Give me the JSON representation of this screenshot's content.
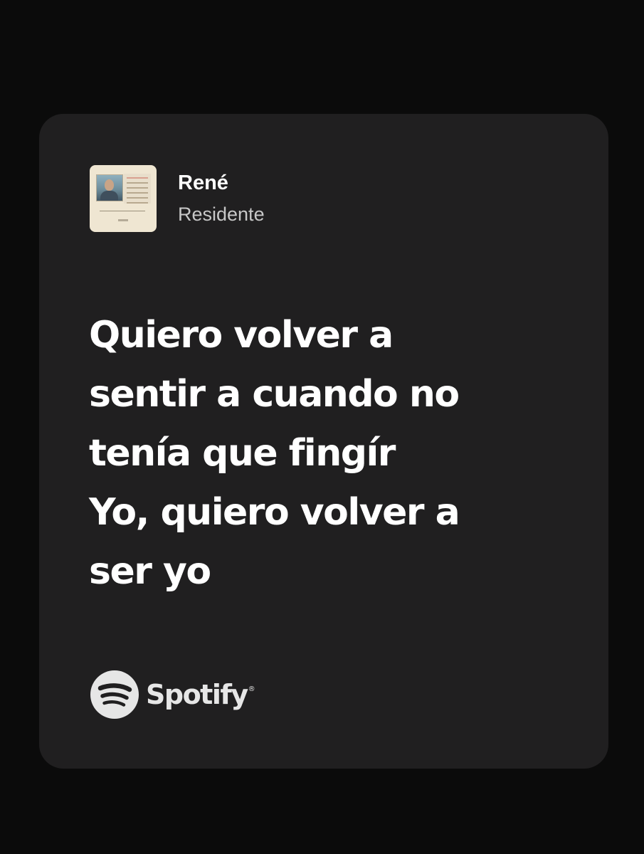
{
  "track": {
    "title": "René",
    "artist": "Residente"
  },
  "lyrics": [
    "Quiero volver a",
    "sentir a cuando no",
    "tenía que fingír",
    "Yo, quiero volver a",
    "ser yo"
  ],
  "brand": {
    "name": "Spotify",
    "icon": "spotify-logo-icon"
  },
  "colors": {
    "background": "#0b0b0b",
    "card": "#201f20",
    "text_primary": "#ffffff",
    "text_secondary": "#c7c7c7"
  }
}
